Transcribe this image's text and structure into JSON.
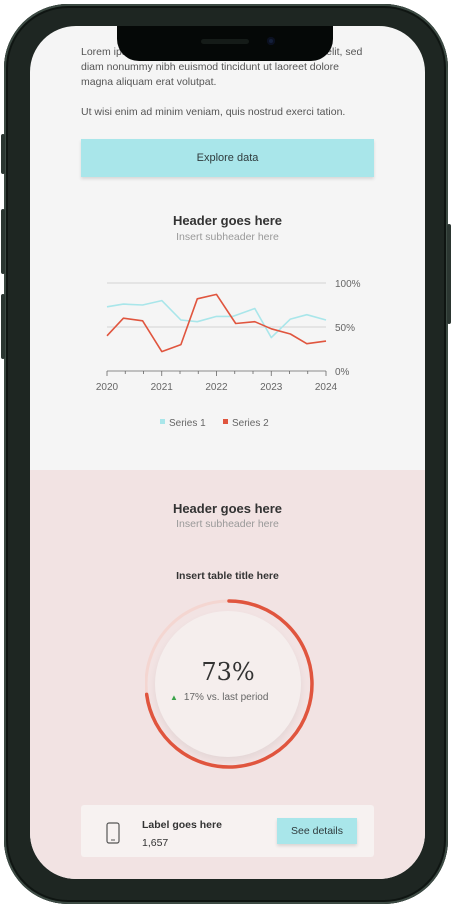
{
  "intro": {
    "line1": "Lorem ipsum dolor sit amet, consectetuer adipiscing elit, sed",
    "line2": "diam nonummy nibh euismod tincidunt ut laoreet dolore",
    "line3": "magna aliquam erat volutpat.",
    "line4": "Ut wisi enim ad minim veniam, quis nostrud exerci tation."
  },
  "explore_button": {
    "label": "Explore data"
  },
  "chart_section": {
    "header": "Header goes here",
    "subheader": "Insert subheader here"
  },
  "chart_data": {
    "type": "line",
    "x_ticks": [
      "2020",
      "2021",
      "2022",
      "2023",
      "2024"
    ],
    "y_ticks": [
      "100%",
      "50%",
      "0%"
    ],
    "ylim": [
      0,
      100
    ],
    "xlim": [
      2020,
      2024
    ],
    "grid": true,
    "legend": "bottom",
    "series": [
      {
        "name": "Series 1",
        "color": "#a9e6ea",
        "points": [
          [
            2020,
            73
          ],
          [
            2020.3,
            76
          ],
          [
            2020.65,
            75
          ],
          [
            2021,
            80
          ],
          [
            2021.35,
            58
          ],
          [
            2021.65,
            56
          ],
          [
            2022,
            62
          ],
          [
            2022.3,
            62
          ],
          [
            2022.7,
            71
          ],
          [
            2023,
            38
          ],
          [
            2023.35,
            59
          ],
          [
            2023.65,
            64
          ],
          [
            2024,
            58
          ]
        ]
      },
      {
        "name": "Series 2",
        "color": "#e0553e",
        "points": [
          [
            2020,
            40
          ],
          [
            2020.3,
            60
          ],
          [
            2020.65,
            57
          ],
          [
            2021,
            22
          ],
          [
            2021.35,
            30
          ],
          [
            2021.65,
            82
          ],
          [
            2022,
            87
          ],
          [
            2022.35,
            54
          ],
          [
            2022.7,
            56
          ],
          [
            2023,
            48
          ],
          [
            2023.35,
            42
          ],
          [
            2023.65,
            31
          ],
          [
            2024,
            34
          ]
        ]
      }
    ]
  },
  "gauge_section": {
    "header": "Header goes here",
    "subheader": "Insert subheader here",
    "table_title": "Insert table title here",
    "value": "73%",
    "fraction": 0.73,
    "delta": "17% vs. last period",
    "ring_color": "#e0553e",
    "track_color": "#f4d6d1",
    "up_color": "#3aa34a"
  },
  "card": {
    "icon": "smartphone-icon",
    "label": "Label goes here",
    "value": "1,657",
    "button_label": "See details"
  },
  "colors": {
    "accent": "#a9e6ea",
    "pink_bg": "#f2e3e3",
    "screen_bg": "#f5f5f5"
  }
}
